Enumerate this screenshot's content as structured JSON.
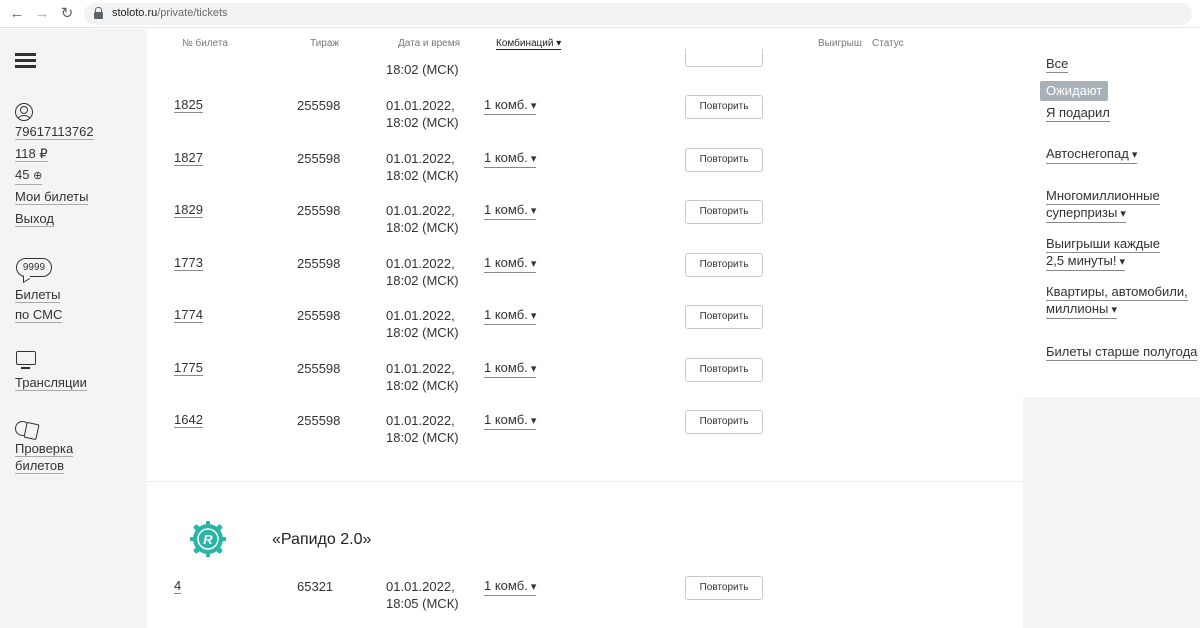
{
  "browser": {
    "url_host": "stoloto.ru",
    "url_path": "/private/tickets"
  },
  "sidebar": {
    "phone": "79617113762",
    "balance": "118 ₽",
    "bonus": "45",
    "my_tickets": "Мои билеты",
    "logout": "Выход",
    "sms_badge": "9999",
    "sms_line1": "Билеты",
    "sms_line2": "по СМС",
    "broadcasts": "Трансляции",
    "check_line1": "Проверка",
    "check_line2": "билетов"
  },
  "table": {
    "headers": {
      "number": "№ билета",
      "draw": "Тираж",
      "datetime": "Дата и время",
      "combos": "Комбинаций",
      "prize": "Выигрыш",
      "status": "Статус"
    },
    "clipped_top_time": "18:02 (МСК)",
    "rows": [
      {
        "number": "1825",
        "draw": "255598",
        "date": "01.01.2022,",
        "time": "18:02 (МСК)",
        "combos": "1 комб.",
        "button": "Повторить"
      },
      {
        "number": "1827",
        "draw": "255598",
        "date": "01.01.2022,",
        "time": "18:02 (МСК)",
        "combos": "1 комб.",
        "button": "Повторить"
      },
      {
        "number": "1829",
        "draw": "255598",
        "date": "01.01.2022,",
        "time": "18:02 (МСК)",
        "combos": "1 комб.",
        "button": "Повторить"
      },
      {
        "number": "1773",
        "draw": "255598",
        "date": "01.01.2022,",
        "time": "18:02 (МСК)",
        "combos": "1 комб.",
        "button": "Повторить"
      },
      {
        "number": "1774",
        "draw": "255598",
        "date": "01.01.2022,",
        "time": "18:02 (МСК)",
        "combos": "1 комб.",
        "button": "Повторить"
      },
      {
        "number": "1775",
        "draw": "255598",
        "date": "01.01.2022,",
        "time": "18:02 (МСК)",
        "combos": "1 комб.",
        "button": "Повторить"
      },
      {
        "number": "1642",
        "draw": "255598",
        "date": "01.01.2022,",
        "time": "18:02 (МСК)",
        "combos": "1 комб.",
        "button": "Повторить"
      }
    ],
    "game_title": "«Рапидо 2.0»",
    "game_rows": [
      {
        "number": "4",
        "draw": "65321",
        "date": "01.01.2022,",
        "time": "18:05 (МСК)",
        "combos": "1 комб.",
        "button": "Повторить"
      }
    ]
  },
  "filters": {
    "all": "Все",
    "pending": "Ожидают",
    "gifted": "Я подарил",
    "auto_snowfall": "Автоснегопад",
    "multimillion_1": "Многомиллионные",
    "multimillion_2": "суперпризы",
    "every_2_5_1": "Выигрыши каждые",
    "every_2_5_2": "2,5 минуты!",
    "apartments_1": "Квартиры, автомобили,",
    "apartments_2": "миллионы",
    "older": "Билеты старше полугода"
  },
  "colors": {
    "game_logo": "#2bb5a6",
    "active_filter_bg": "#a8b0b8",
    "sidebar_bg": "#f4f4f4"
  }
}
